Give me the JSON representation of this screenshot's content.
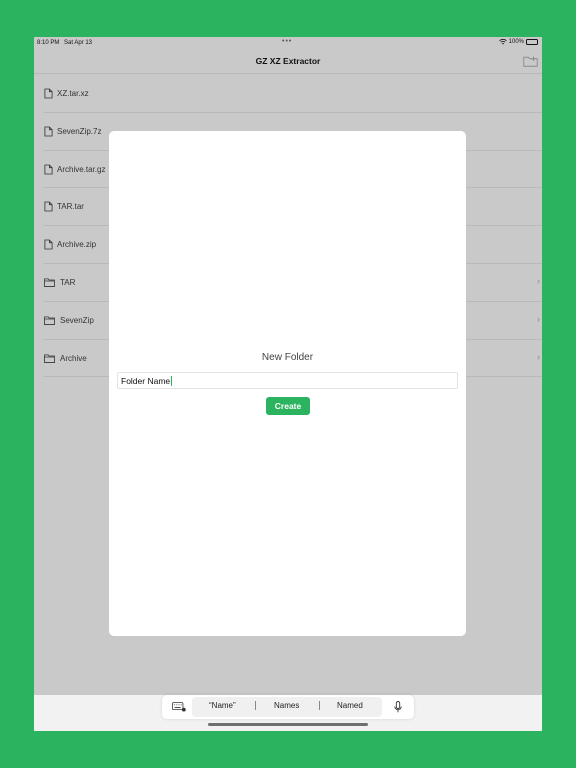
{
  "status": {
    "time": "8:10 PM",
    "date": "Sat Apr 13",
    "battery": "100%"
  },
  "nav": {
    "title": "GZ XZ Extractor",
    "folder_icon": "folder-add-icon"
  },
  "files": [
    {
      "label": "XZ.tar.xz",
      "icon": "file-icon"
    },
    {
      "label": "SevenZip.7z",
      "icon": "file-icon"
    },
    {
      "label": "Archive.tar.gz",
      "icon": "file-icon"
    },
    {
      "label": "TAR.tar",
      "icon": "file-icon"
    },
    {
      "label": "Archive.zip",
      "icon": "file-icon"
    },
    {
      "label": "TAR",
      "icon": "folder-icon",
      "chevron": "›"
    },
    {
      "label": "SevenZip",
      "icon": "folder-icon",
      "chevron": "›"
    },
    {
      "label": "Archive",
      "icon": "folder-icon",
      "chevron": "›"
    }
  ],
  "modal": {
    "title": "New Folder",
    "input_value": "Folder Name",
    "create_label": "Create"
  },
  "keyboard": {
    "suggestions": [
      "“Name”",
      "Names",
      "Named"
    ]
  },
  "colors": {
    "accent": "#2bb35f",
    "background": "#2bb35f"
  }
}
